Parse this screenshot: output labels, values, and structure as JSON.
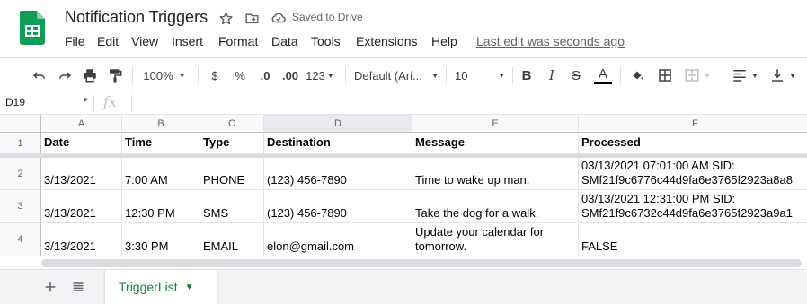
{
  "header": {
    "title": "Notification Triggers",
    "saved_status": "Saved to Drive",
    "last_edit": "Last edit was seconds ago",
    "menu": [
      "File",
      "Edit",
      "View",
      "Insert",
      "Format",
      "Data",
      "Tools",
      "Extensions",
      "Help"
    ]
  },
  "toolbar": {
    "zoom": "100%",
    "currency": "$",
    "percent": "%",
    "decrease_decimal": ".0",
    "increase_decimal": ".00",
    "more_formats": "123",
    "font": "Default (Ari...",
    "font_size": "10",
    "text_color": "#000000"
  },
  "formula_bar": {
    "name_box": "D19",
    "fx": "fx",
    "content": ""
  },
  "sheet": {
    "columns": [
      "A",
      "B",
      "C",
      "D",
      "E",
      "F"
    ],
    "selected_column": "D",
    "rows": [
      "1",
      "2",
      "3",
      "4"
    ],
    "headers": [
      "Date",
      "Time",
      "Type",
      "Destination",
      "Message",
      "Processed"
    ],
    "data": [
      [
        "3/13/2021",
        "7:00 AM",
        "PHONE",
        "(123) 456-7890",
        "Time to wake up man.",
        "03/13/2021 07:01:00 AM SID: SMf21f9c6776c44d9fa6e3765f2923a8a8"
      ],
      [
        "3/13/2021",
        "12:30 PM",
        "SMS",
        "(123) 456-7890",
        "Take the dog for a walk.",
        "03/13/2021 12:31:00 PM SID: SMf21f9c6732c44d9fa6e3765f2923a9a1"
      ],
      [
        "3/13/2021",
        "3:30 PM",
        "EMAIL",
        "elon@gmail.com",
        "Update your calendar for tomorrow.",
        "FALSE"
      ]
    ]
  },
  "bottom_bar": {
    "active_sheet": "TriggerList",
    "tab_color": "#188038"
  },
  "colors": {
    "brand_green": "#0f9d58",
    "header_bg": "#f8f9fa",
    "gridline": "#e2e3e3"
  }
}
